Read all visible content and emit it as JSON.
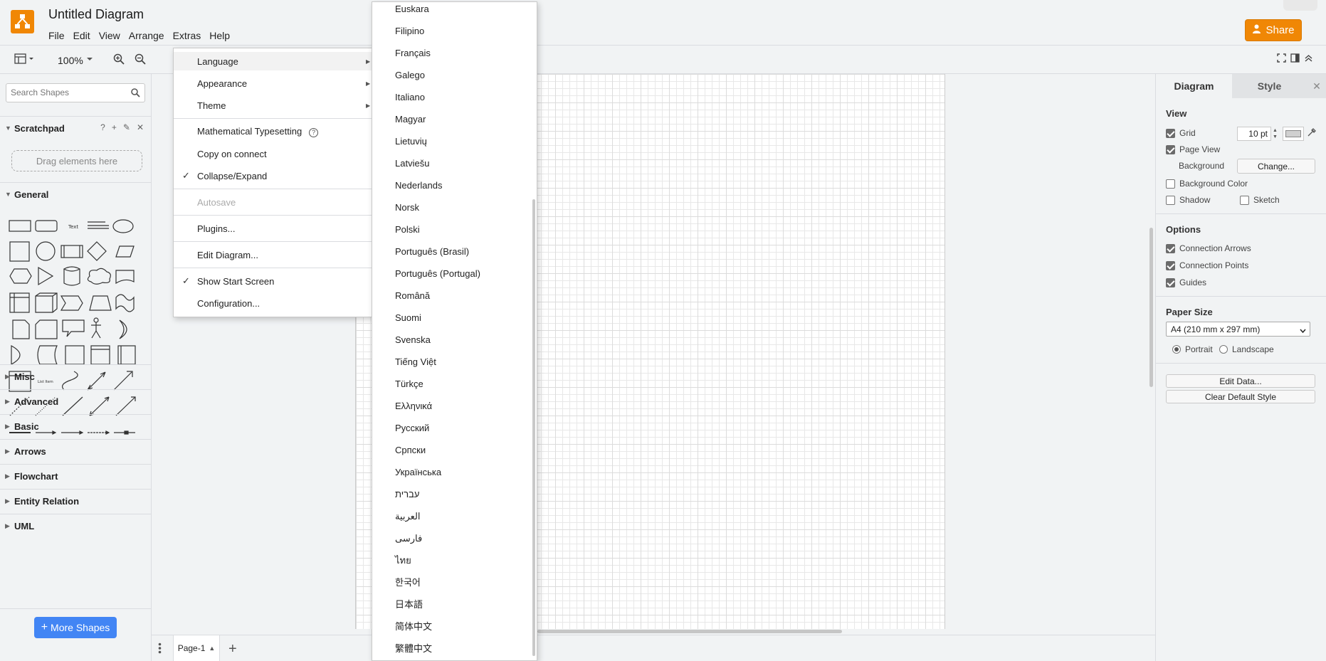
{
  "app": {
    "title": "Untitled Diagram",
    "share_label": "Share",
    "accent": "#f08705"
  },
  "menubar": [
    "File",
    "Edit",
    "View",
    "Arrange",
    "Extras",
    "Help"
  ],
  "toolbar": {
    "zoom": "100%"
  },
  "sidebar": {
    "search_placeholder": "Search Shapes",
    "scratchpad_title": "Scratchpad",
    "scratchpad_tools": [
      "?",
      "+",
      "✎",
      "✕"
    ],
    "drag_hint": "Drag elements here",
    "general_title": "General",
    "sections": [
      "Misc",
      "Advanced",
      "Basic",
      "Arrows",
      "Flowchart",
      "Entity Relation",
      "UML"
    ],
    "more_shapes": "More Shapes"
  },
  "pages": {
    "current": "Page-1"
  },
  "format_panel": {
    "tabs": [
      "Diagram",
      "Style"
    ],
    "view_title": "View",
    "grid_label": "Grid",
    "grid_size": "10 pt",
    "page_view_label": "Page View",
    "background_label": "Background",
    "change_label": "Change...",
    "background_color_label": "Background Color",
    "shadow_label": "Shadow",
    "sketch_label": "Sketch",
    "options_title": "Options",
    "connection_arrows_label": "Connection Arrows",
    "connection_points_label": "Connection Points",
    "guides_label": "Guides",
    "paper_size_title": "Paper Size",
    "paper_size_value": "A4 (210 mm x 297 mm)",
    "portrait_label": "Portrait",
    "landscape_label": "Landscape",
    "edit_data_label": "Edit Data...",
    "clear_default_style_label": "Clear Default Style"
  },
  "extras_menu": {
    "language": "Language",
    "appearance": "Appearance",
    "theme": "Theme",
    "math": "Mathematical Typesetting",
    "copy_on_connect": "Copy on connect",
    "collapse_expand": "Collapse/Expand",
    "autosave": "Autosave",
    "plugins": "Plugins...",
    "edit_diagram": "Edit Diagram...",
    "show_start_screen": "Show Start Screen",
    "configuration": "Configuration..."
  },
  "languages": [
    "Euskara",
    "Filipino",
    "Français",
    "Galego",
    "Italiano",
    "Magyar",
    "Lietuvių",
    "Latviešu",
    "Nederlands",
    "Norsk",
    "Polski",
    "Português (Brasil)",
    "Português (Portugal)",
    "Română",
    "Suomi",
    "Svenska",
    "Tiếng Việt",
    "Türkçe",
    "Ελληνικά",
    "Русский",
    "Српски",
    "Українська",
    "עברית",
    "العربية",
    "فارسی",
    "ไทย",
    "한국어",
    "日本語",
    "简体中文",
    "繁體中文"
  ]
}
